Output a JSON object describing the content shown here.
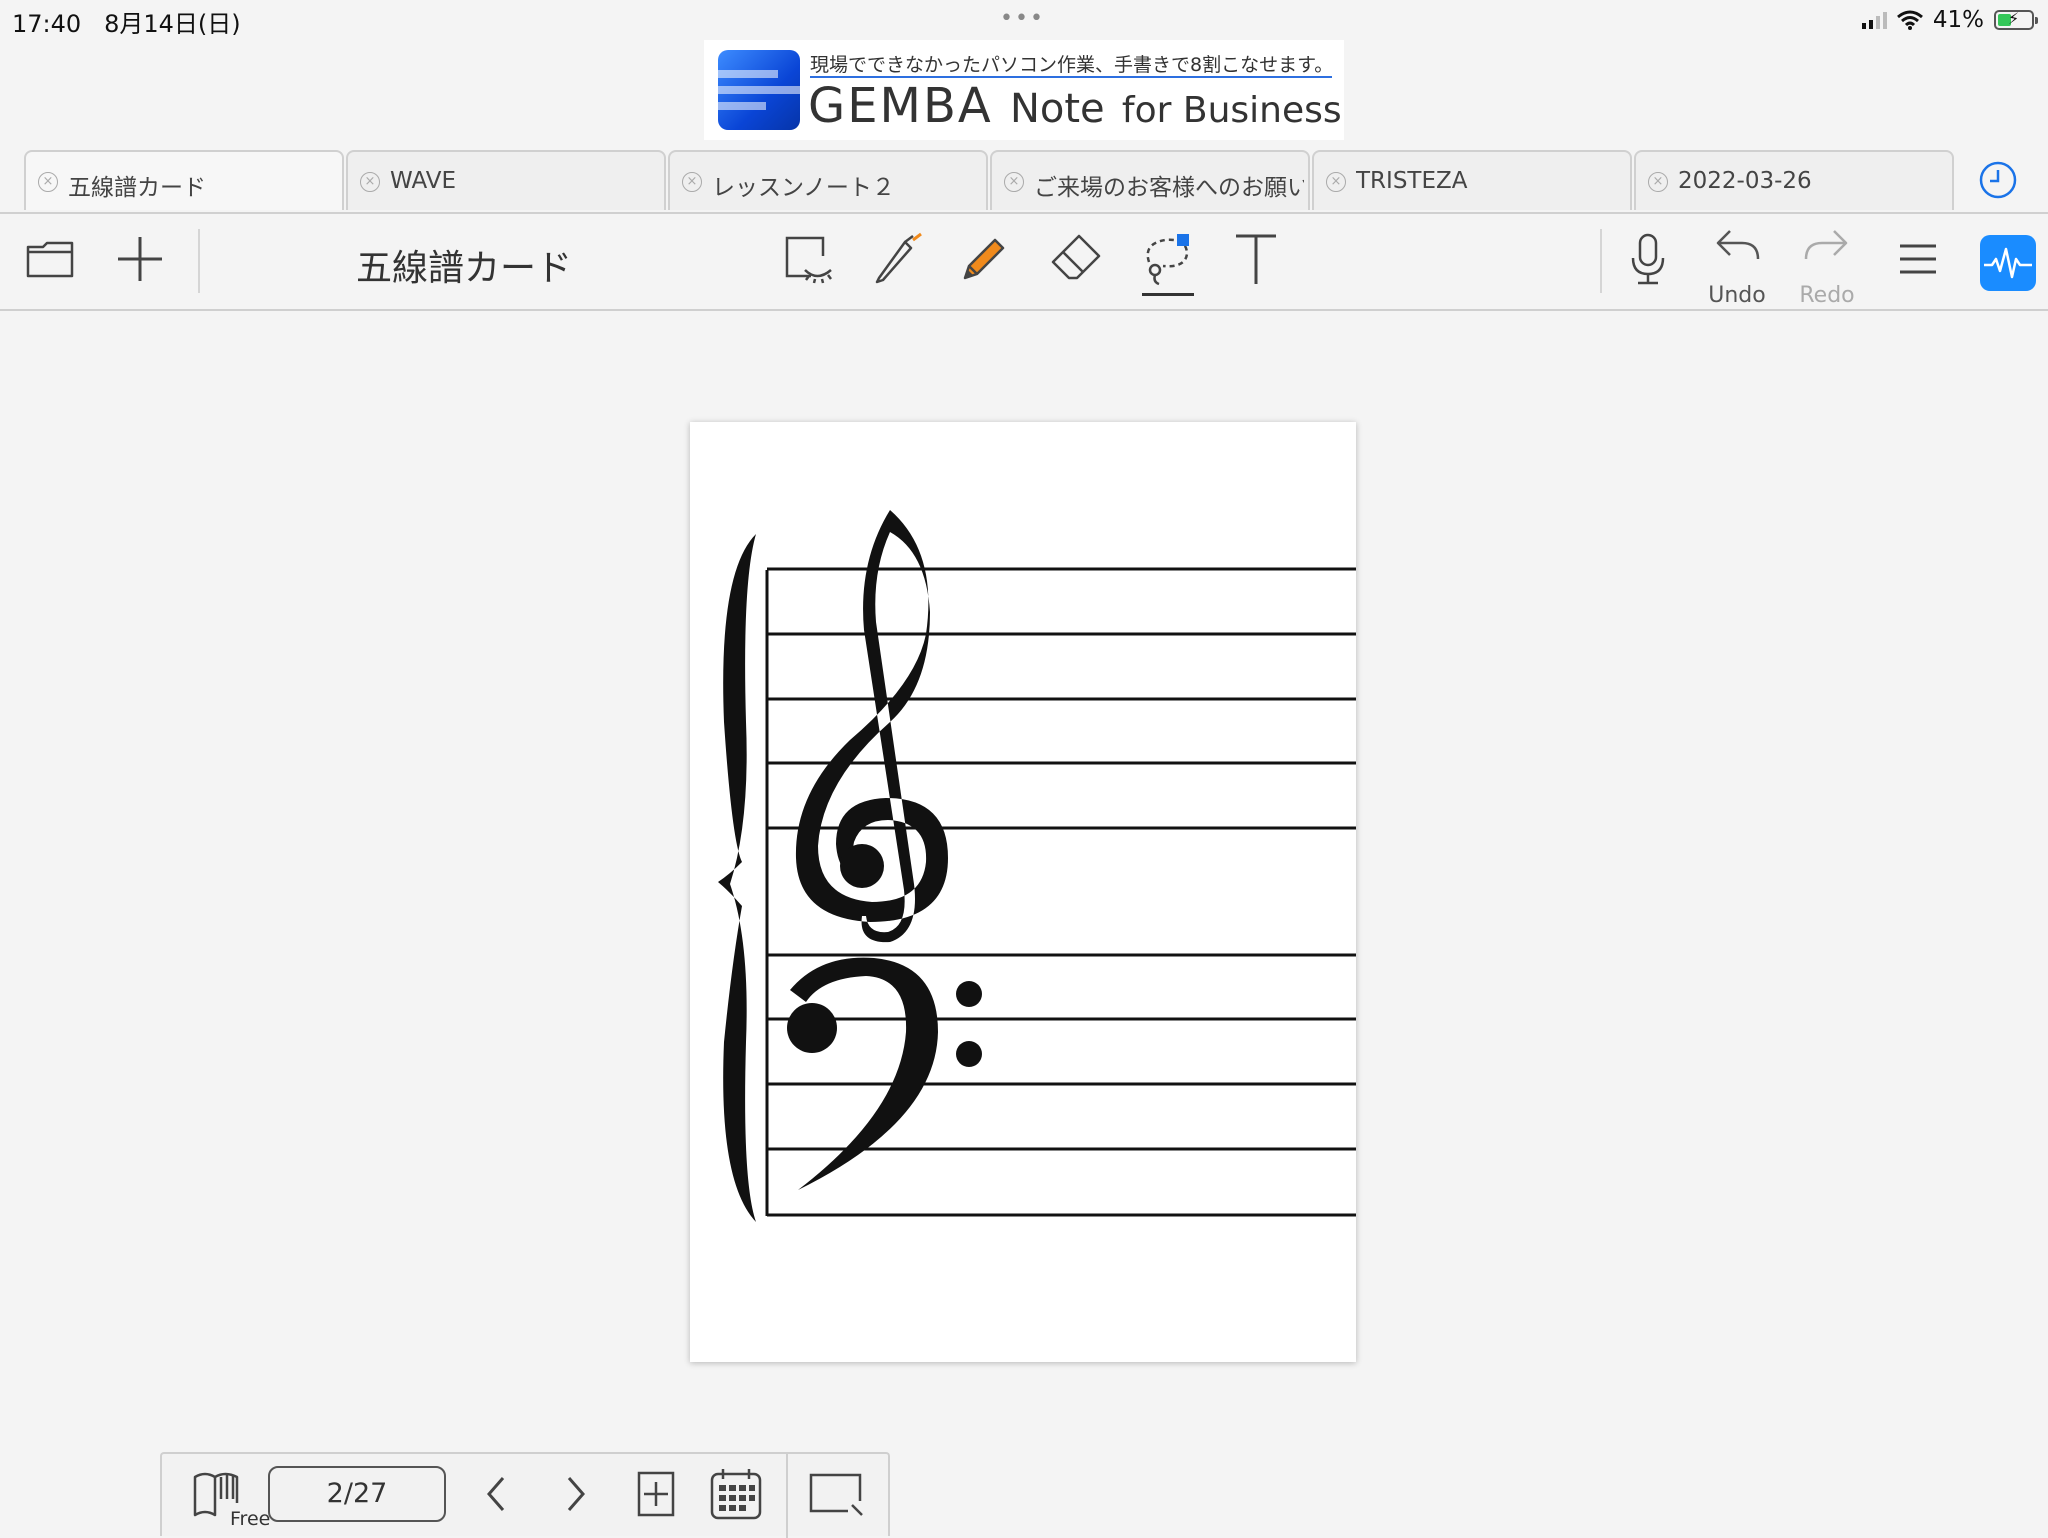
{
  "status_bar": {
    "time": "17:40",
    "date": "8月14日(日)",
    "battery_percent": "41%",
    "battery_level": 0.41,
    "more_dots": "•••"
  },
  "banner": {
    "tagline": "現場でできなかったパソコン作業、手書きで8割こなせます。",
    "brand": "GEMBA",
    "product": "Note",
    "suffix": "for Business"
  },
  "tabs": [
    {
      "label": "五線譜カード",
      "active": true
    },
    {
      "label": "WAVE",
      "active": false
    },
    {
      "label": "レッスンノート２",
      "active": false
    },
    {
      "label": "ご来場のお客様へのお願い",
      "active": false
    },
    {
      "label": "TRISTEZA",
      "active": false
    },
    {
      "label": "2022-03-26",
      "active": false
    }
  ],
  "toolbar": {
    "notebook_title": "五線譜カード",
    "undo_label": "Undo",
    "redo_label": "Redo",
    "pencil_color": "#f08a1c",
    "lasso_accent": "#1a73e8",
    "wave_color": "#1a8cff"
  },
  "bottom_bar": {
    "page_indicator": "2/27",
    "mode_label": "Free"
  },
  "icons": {
    "close": "×"
  }
}
